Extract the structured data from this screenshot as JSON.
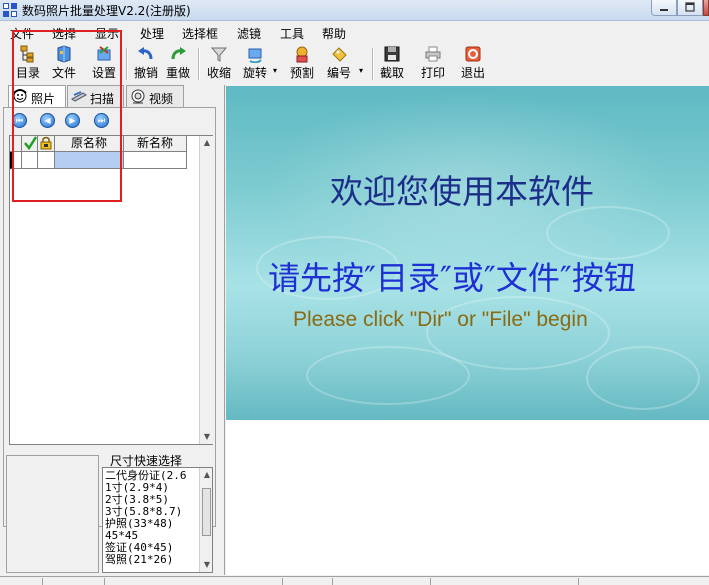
{
  "window": {
    "title": "数码照片批量处理V2.2(注册版)"
  },
  "menu": [
    "文件",
    "选择",
    "显示",
    "处理",
    "选择框",
    "滤镜",
    "工具",
    "帮助"
  ],
  "toolbar": [
    {
      "label": "目录",
      "icon": "folder-tree-icon"
    },
    {
      "label": "文件",
      "icon": "file-icon"
    },
    {
      "label": "设置",
      "icon": "settings-icon"
    },
    {
      "label": "撤销",
      "icon": "undo-icon"
    },
    {
      "label": "重做",
      "icon": "redo-icon"
    },
    {
      "label": "收缩",
      "icon": "funnel-icon"
    },
    {
      "label": "旋转",
      "icon": "rotate-icon"
    },
    {
      "label": "预割",
      "icon": "precut-icon"
    },
    {
      "label": "编号",
      "icon": "numbering-icon"
    },
    {
      "label": "截取",
      "icon": "capture-icon"
    },
    {
      "label": "打印",
      "icon": "printer-icon"
    },
    {
      "label": "退出",
      "icon": "exit-icon"
    }
  ],
  "tabs": [
    {
      "label": "照片",
      "icon": "photo-icon"
    },
    {
      "label": "扫描",
      "icon": "scanner-icon"
    },
    {
      "label": "视频",
      "icon": "camera-icon"
    }
  ],
  "grid": {
    "headers": [
      "原名称",
      "新名称"
    ]
  },
  "size_panel": {
    "title": "尺寸快速选择",
    "items": [
      "二代身份证(2.6",
      "1寸(2.9*4)",
      "2寸(3.8*5)",
      "3寸(5.8*8.7)",
      "护照(33*48)",
      "45*45",
      "签证(40*45)",
      "驾照(21*26)"
    ]
  },
  "preview": {
    "welcome": "欢迎您使用本软件",
    "instruction": "请先按″目录″或″文件″按钮",
    "english": "Please click \"Dir\" or \"File\" begin"
  },
  "colors": {
    "title_bar": "#c9daee",
    "highlight": "#e02020",
    "welcome_text": "#1d2e8a",
    "instruction_text": "#1e2fd4",
    "english_text": "#8a6a12"
  }
}
